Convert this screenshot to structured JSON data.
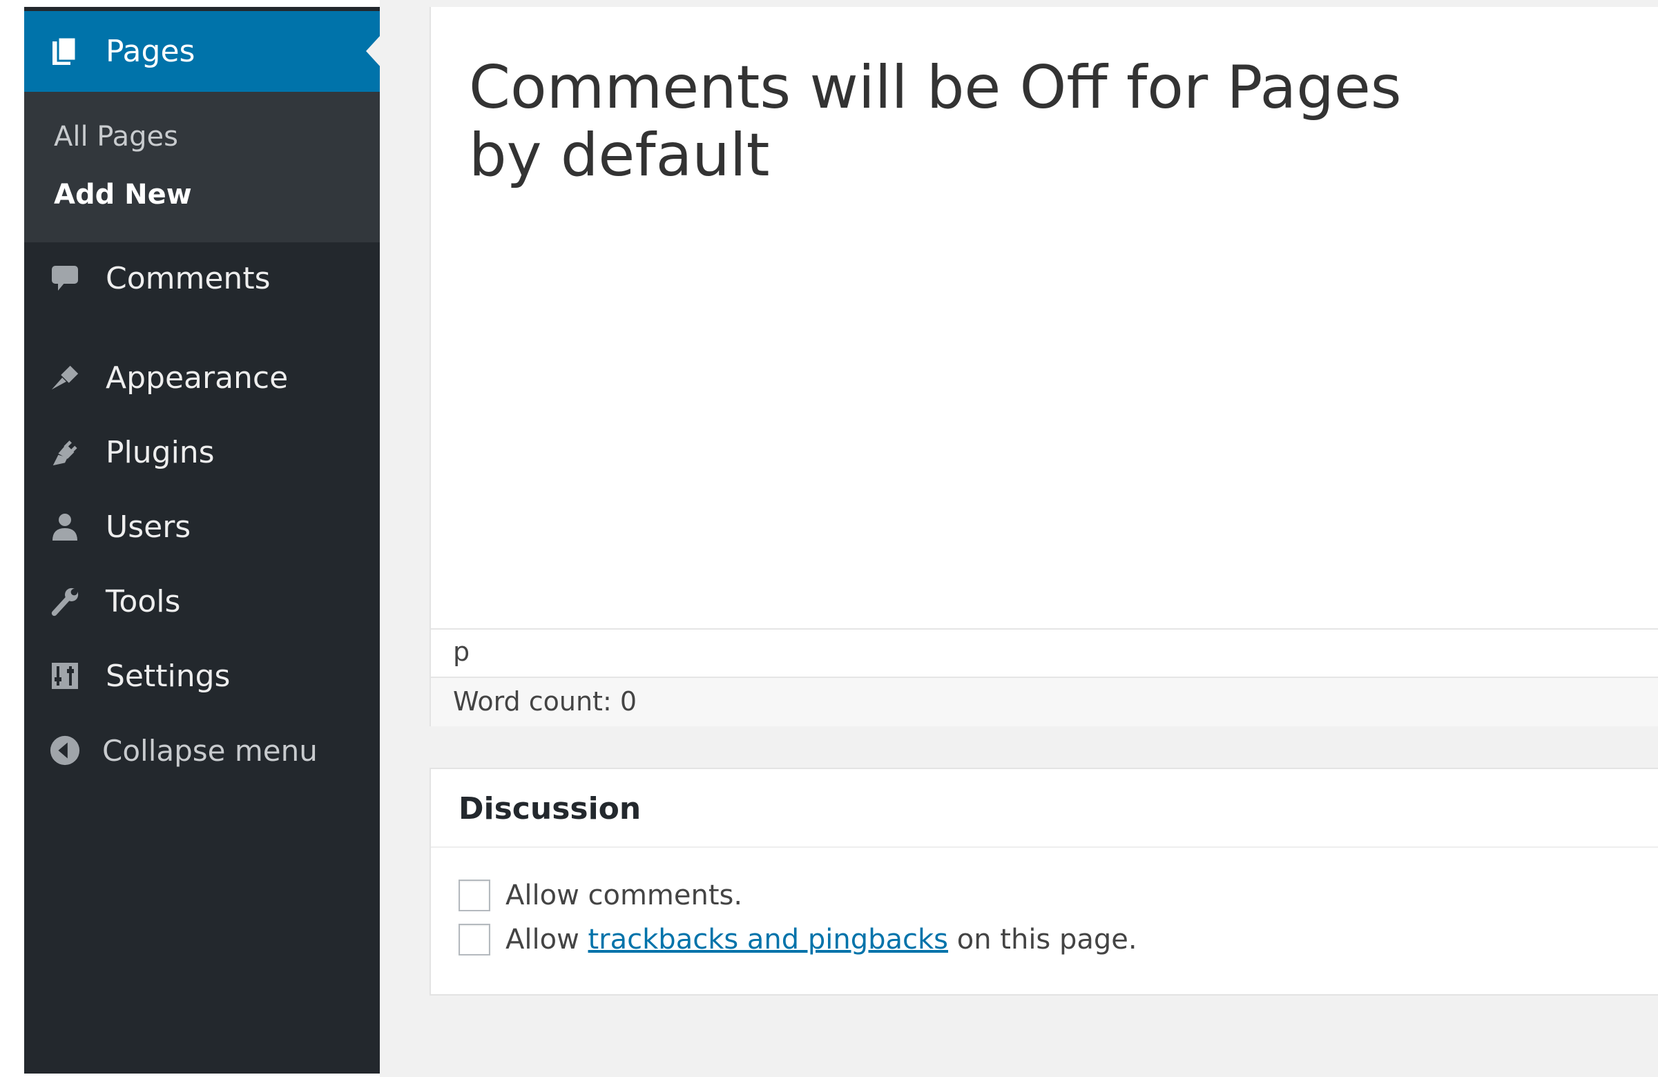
{
  "sidebar": {
    "current": {
      "label": "Pages",
      "icon": "pages-icon"
    },
    "submenu": [
      {
        "label": "All Pages",
        "active": false
      },
      {
        "label": "Add New",
        "active": true
      }
    ],
    "items": [
      {
        "label": "Comments",
        "icon": "comments-icon"
      },
      {
        "label": "Appearance",
        "icon": "appearance-icon"
      },
      {
        "label": "Plugins",
        "icon": "plugins-icon"
      },
      {
        "label": "Users",
        "icon": "users-icon"
      },
      {
        "label": "Tools",
        "icon": "tools-icon"
      },
      {
        "label": "Settings",
        "icon": "settings-icon"
      }
    ],
    "collapse": {
      "label": "Collapse menu",
      "icon": "collapse-icon"
    }
  },
  "editor": {
    "content_line1": "Comments will be Off for Pages",
    "content_line2": "by default",
    "path": "p",
    "word_count": "Word count: 0"
  },
  "discussion": {
    "title": "Discussion",
    "allow_comments": {
      "label": "Allow comments.",
      "checked": false
    },
    "allow_trackbacks": {
      "prefix": "Allow ",
      "link": "trackbacks and pingbacks",
      "suffix": " on this page.",
      "checked": false
    }
  },
  "colors": {
    "sidebar_bg": "#23282d",
    "submenu_bg": "#32373c",
    "accent": "#0073aa",
    "main_bg": "#f1f1f1"
  }
}
